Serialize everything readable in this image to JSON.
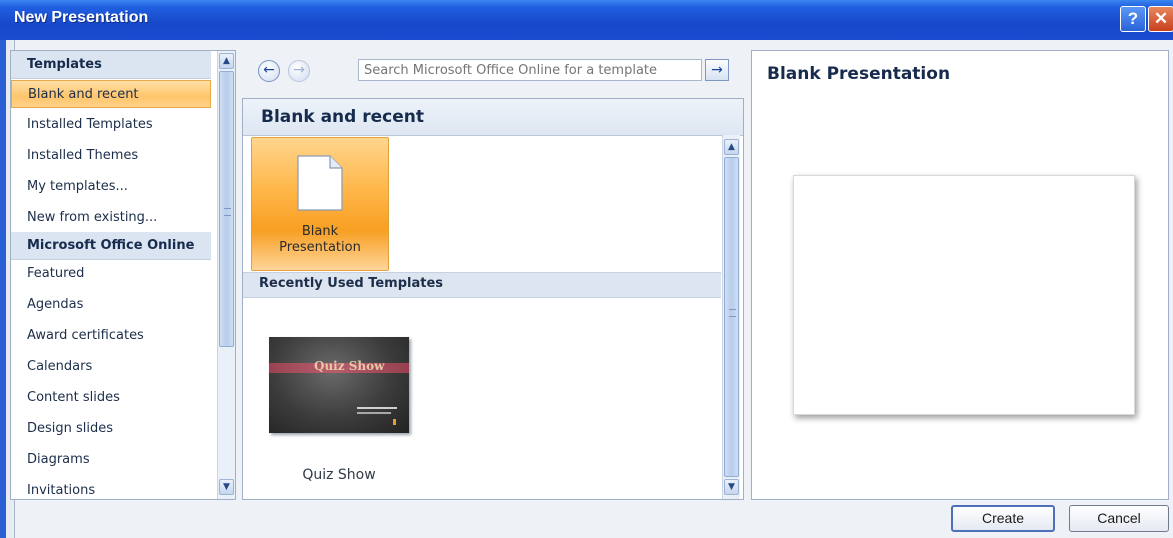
{
  "window": {
    "title": "New Presentation",
    "help_glyph": "?",
    "close_glyph": "✕"
  },
  "sidebar": {
    "items": [
      {
        "label": "Templates",
        "type": "header"
      },
      {
        "label": "Blank and recent",
        "type": "selected"
      },
      {
        "label": "Installed Templates",
        "type": "item"
      },
      {
        "label": "Installed Themes",
        "type": "item"
      },
      {
        "label": "My templates...",
        "type": "item"
      },
      {
        "label": "New from existing...",
        "type": "item"
      },
      {
        "label": "Microsoft Office Online",
        "type": "header"
      },
      {
        "label": "Featured",
        "type": "item"
      },
      {
        "label": "Agendas",
        "type": "item"
      },
      {
        "label": "Award certificates",
        "type": "item"
      },
      {
        "label": "Calendars",
        "type": "item"
      },
      {
        "label": "Content slides",
        "type": "item"
      },
      {
        "label": "Design slides",
        "type": "item"
      },
      {
        "label": "Diagrams",
        "type": "item"
      },
      {
        "label": "Invitations",
        "type": "item"
      }
    ]
  },
  "toolbar": {
    "back_icon": "arrow-left-icon",
    "forward_icon": "arrow-right-icon",
    "search_placeholder": "Search Microsoft Office Online for a template",
    "search_go_icon": "arrow-right-icon"
  },
  "center": {
    "heading": "Blank and recent",
    "blank_tile_label_line1": "Blank",
    "blank_tile_label_line2": "Presentation",
    "recent_section": "Recently Used Templates",
    "recent_templates": [
      {
        "name": "Quiz Show",
        "thumb_title": "Quiz Show"
      }
    ]
  },
  "preview": {
    "title": "Blank Presentation"
  },
  "buttons": {
    "create": "Create",
    "cancel": "Cancel"
  },
  "colors": {
    "titlebar": "#1f5fe0",
    "selection": "#ffc56b",
    "header_text": "#172b4d"
  }
}
